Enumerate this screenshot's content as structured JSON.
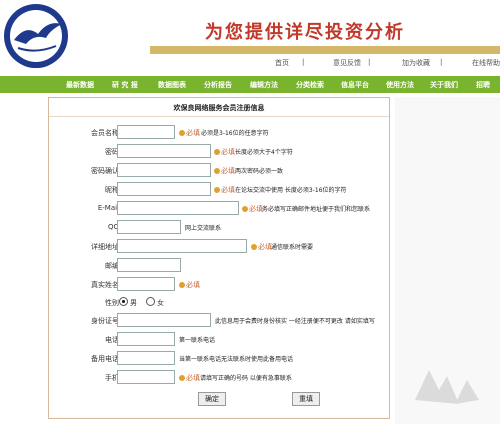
{
  "header": {
    "logo_text": "",
    "slogan": "为您提供详尽投资分析",
    "top_links": [
      "首页",
      "意见反馈",
      "加为收藏",
      "在线帮助"
    ]
  },
  "nav": {
    "items": [
      "最新数据",
      "研 究 报",
      "数据图表",
      "分析报告",
      "编辑方法",
      "分类检索",
      "信息平台",
      "使用方法",
      "关于我们",
      "招聘"
    ]
  },
  "form": {
    "title": "欢保良网络服务会员注册信息",
    "fields": [
      {
        "label": "会员名称",
        "required": "必填",
        "hint": "必须是3-16位的任意字符"
      },
      {
        "label": "密码",
        "required": "必填",
        "hint": "长度必须大于4个字符"
      },
      {
        "label": "密码确认",
        "required": "必填",
        "hint": "两次密码必须一致"
      },
      {
        "label": "昵称",
        "required": "必填",
        "hint": "在论坛交流中使用 长度必须3-16位的字符"
      },
      {
        "label": "E-Mail",
        "required": "必填",
        "hint": "务必填写正确邮件地址便于我们和您联系"
      },
      {
        "label": "QQ",
        "required": "",
        "hint": "网上交流联系"
      },
      {
        "label": "详细地址",
        "required": "必填",
        "hint": "通信联系时需要"
      },
      {
        "label": "邮编",
        "required": "",
        "hint": ""
      },
      {
        "label": "真实姓名",
        "required": "必填",
        "hint": ""
      },
      {
        "label": "性别",
        "required": "",
        "hint": ""
      },
      {
        "label": "身份证号",
        "required": "",
        "hint": "此信息用于会费时身份核实 一经注册便不可更改 请如实填写"
      },
      {
        "label": "电话",
        "required": "",
        "hint": "第一联系电话"
      },
      {
        "label": "备用电话",
        "required": "",
        "hint": "当第一联系电话无法联系时使用此备用电话"
      },
      {
        "label": "手机",
        "required": "必填",
        "hint": "请填写正确的号码 以便有急事联系"
      }
    ],
    "gender": {
      "male": "男",
      "female": "女",
      "selected": "male"
    },
    "submit_label": "确定",
    "reset_label": "重填"
  }
}
